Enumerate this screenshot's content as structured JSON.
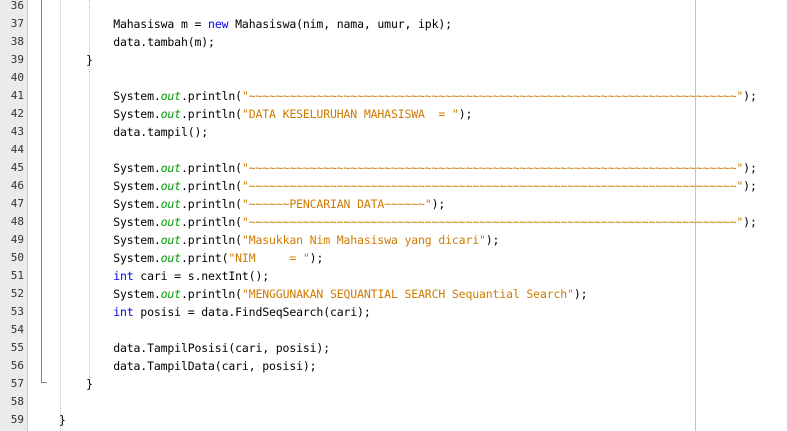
{
  "editor": {
    "lines": [
      {
        "num": "36",
        "indent": "",
        "tokens": []
      },
      {
        "num": "37",
        "indent": "        ",
        "tokens": [
          {
            "t": "Mahasiswa m = "
          },
          {
            "t": "new",
            "c": "kw"
          },
          {
            "t": " Mahasiswa(nim, nama, umur, ipk);"
          }
        ]
      },
      {
        "num": "38",
        "indent": "        ",
        "tokens": [
          {
            "t": "data.tambah(m);"
          }
        ]
      },
      {
        "num": "39",
        "indent": "    ",
        "tokens": [
          {
            "t": "}"
          }
        ]
      },
      {
        "num": "40",
        "indent": "",
        "tokens": []
      },
      {
        "num": "41",
        "indent": "        ",
        "tokens": [
          {
            "t": "System."
          },
          {
            "t": "out",
            "c": "fld"
          },
          {
            "t": ".println("
          },
          {
            "t": "\"~~~~~~~~~~~~~~~~~~~~~~~~~~~~~~~~~~~~~~~~~~~~~~~~~~~~~~~~~~~~~~~~~~~~~~~~\"",
            "c": "str"
          },
          {
            "t": ");"
          }
        ]
      },
      {
        "num": "42",
        "indent": "        ",
        "tokens": [
          {
            "t": "System."
          },
          {
            "t": "out",
            "c": "fld"
          },
          {
            "t": ".println("
          },
          {
            "t": "\"DATA KESELURUHAN MAHASISWA  = \"",
            "c": "str"
          },
          {
            "t": ");"
          }
        ]
      },
      {
        "num": "43",
        "indent": "        ",
        "tokens": [
          {
            "t": "data.tampil();"
          }
        ]
      },
      {
        "num": "44",
        "indent": "",
        "tokens": []
      },
      {
        "num": "45",
        "indent": "        ",
        "tokens": [
          {
            "t": "System."
          },
          {
            "t": "out",
            "c": "fld"
          },
          {
            "t": ".println("
          },
          {
            "t": "\"~~~~~~~~~~~~~~~~~~~~~~~~~~~~~~~~~~~~~~~~~~~~~~~~~~~~~~~~~~~~~~~~~~~~~~~~\"",
            "c": "str"
          },
          {
            "t": ");"
          }
        ]
      },
      {
        "num": "46",
        "indent": "        ",
        "tokens": [
          {
            "t": "System."
          },
          {
            "t": "out",
            "c": "fld"
          },
          {
            "t": ".println("
          },
          {
            "t": "\"~~~~~~~~~~~~~~~~~~~~~~~~~~~~~~~~~~~~~~~~~~~~~~~~~~~~~~~~~~~~~~~~~~~~~~~~\"",
            "c": "str"
          },
          {
            "t": ");"
          }
        ]
      },
      {
        "num": "47",
        "indent": "        ",
        "tokens": [
          {
            "t": "System."
          },
          {
            "t": "out",
            "c": "fld"
          },
          {
            "t": ".println("
          },
          {
            "t": "\"~~~~~~PENCARIAN DATA~~~~~~\"",
            "c": "str"
          },
          {
            "t": ");"
          }
        ]
      },
      {
        "num": "48",
        "indent": "        ",
        "tokens": [
          {
            "t": "System."
          },
          {
            "t": "out",
            "c": "fld"
          },
          {
            "t": ".println("
          },
          {
            "t": "\"~~~~~~~~~~~~~~~~~~~~~~~~~~~~~~~~~~~~~~~~~~~~~~~~~~~~~~~~~~~~~~~~~~~~~~~~\"",
            "c": "str"
          },
          {
            "t": ");"
          }
        ]
      },
      {
        "num": "49",
        "indent": "        ",
        "tokens": [
          {
            "t": "System."
          },
          {
            "t": "out",
            "c": "fld"
          },
          {
            "t": ".println("
          },
          {
            "t": "\"Masukkan Nim Mahasiswa yang dicari\"",
            "c": "str"
          },
          {
            "t": ");"
          }
        ]
      },
      {
        "num": "50",
        "indent": "        ",
        "tokens": [
          {
            "t": "System."
          },
          {
            "t": "out",
            "c": "fld"
          },
          {
            "t": ".print("
          },
          {
            "t": "\"NIM     = \"",
            "c": "str"
          },
          {
            "t": ");"
          }
        ]
      },
      {
        "num": "51",
        "indent": "        ",
        "tokens": [
          {
            "t": "int",
            "c": "kw"
          },
          {
            "t": " cari = s.nextInt();"
          }
        ]
      },
      {
        "num": "52",
        "indent": "        ",
        "tokens": [
          {
            "t": "System."
          },
          {
            "t": "out",
            "c": "fld"
          },
          {
            "t": ".println("
          },
          {
            "t": "\"MENGGUNAKAN SEQUANTIAL SEARCH Sequantial Search\"",
            "c": "str"
          },
          {
            "t": ");"
          }
        ]
      },
      {
        "num": "53",
        "indent": "        ",
        "tokens": [
          {
            "t": "int",
            "c": "kw"
          },
          {
            "t": " posisi = data.FindSeqSearch(cari);"
          }
        ]
      },
      {
        "num": "54",
        "indent": "",
        "tokens": []
      },
      {
        "num": "55",
        "indent": "        ",
        "tokens": [
          {
            "t": "data.TampilPosisi(cari, posisi);"
          }
        ]
      },
      {
        "num": "56",
        "indent": "        ",
        "tokens": [
          {
            "t": "data.TampilData(cari, posisi);"
          }
        ]
      },
      {
        "num": "57",
        "indent": "    ",
        "tokens": [
          {
            "t": "}"
          }
        ]
      },
      {
        "num": "58",
        "indent": "",
        "tokens": []
      },
      {
        "num": "59",
        "indent": "",
        "tokens": [
          {
            "t": "}"
          }
        ]
      }
    ]
  },
  "colors": {
    "keyword": "#0000e6",
    "field": "#009900",
    "string": "#ce7b00",
    "text": "#000000",
    "gutter": "#ebebeb",
    "margin_line": "#e8b4b4"
  }
}
